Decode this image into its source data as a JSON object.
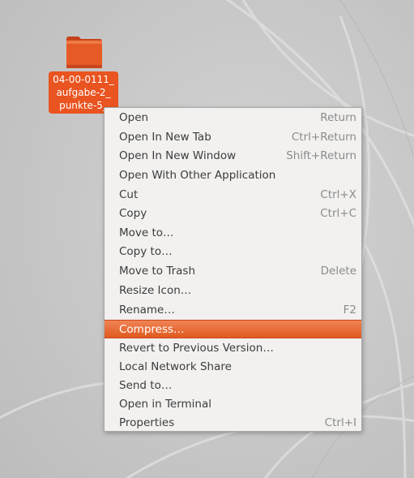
{
  "desktop": {
    "icon": {
      "icon_name": "folder-icon",
      "color": "#e95420",
      "label_lines": [
        "04-00-0111_",
        "aufgabe-2_",
        "punkte-5_"
      ]
    }
  },
  "context_menu": {
    "highlight_color": "#e95420",
    "items": [
      {
        "label": "Open",
        "accel": "Return"
      },
      {
        "label": "Open In New Tab",
        "accel": "Ctrl+Return"
      },
      {
        "label": "Open In New Window",
        "accel": "Shift+Return"
      },
      {
        "label": "Open With Other Application",
        "accel": ""
      },
      {
        "label": "Cut",
        "accel": "Ctrl+X"
      },
      {
        "label": "Copy",
        "accel": "Ctrl+C"
      },
      {
        "label": "Move to…",
        "accel": ""
      },
      {
        "label": "Copy to…",
        "accel": ""
      },
      {
        "label": "Move to Trash",
        "accel": "Delete"
      },
      {
        "label": "Resize Icon…",
        "accel": ""
      },
      {
        "label": "Rename…",
        "accel": "F2"
      },
      {
        "label": "Compress…",
        "accel": "",
        "highlighted": true
      },
      {
        "label": "Revert to Previous Version…",
        "accel": ""
      },
      {
        "label": "Local Network Share",
        "accel": ""
      },
      {
        "label": "Send to…",
        "accel": ""
      },
      {
        "label": "Open in Terminal",
        "accel": ""
      },
      {
        "label": "Properties",
        "accel": "Ctrl+I"
      }
    ]
  }
}
